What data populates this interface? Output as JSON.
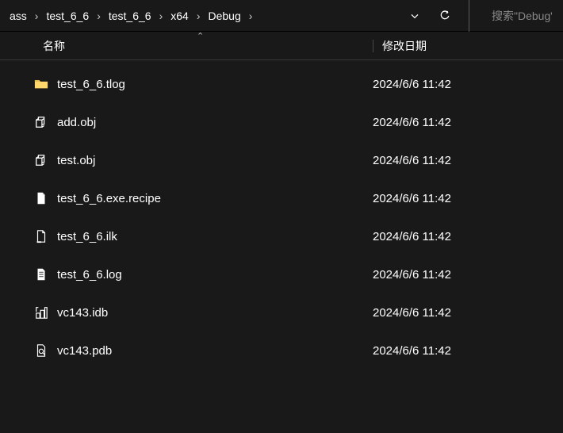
{
  "breadcrumb": {
    "items": [
      {
        "label": "ass"
      },
      {
        "label": "test_6_6"
      },
      {
        "label": "test_6_6"
      },
      {
        "label": "x64"
      },
      {
        "label": "Debug"
      }
    ]
  },
  "search": {
    "placeholder": "搜索\"Debug\""
  },
  "columns": {
    "name": "名称",
    "date": "修改日期"
  },
  "files": [
    {
      "icon": "folder",
      "name": "test_6_6.tlog",
      "date": "2024/6/6 11:42"
    },
    {
      "icon": "obj",
      "name": "add.obj",
      "date": "2024/6/6 11:42"
    },
    {
      "icon": "obj",
      "name": "test.obj",
      "date": "2024/6/6 11:42"
    },
    {
      "icon": "file",
      "name": "test_6_6.exe.recipe",
      "date": "2024/6/6 11:42"
    },
    {
      "icon": "ilk",
      "name": "test_6_6.ilk",
      "date": "2024/6/6 11:42"
    },
    {
      "icon": "log",
      "name": "test_6_6.log",
      "date": "2024/6/6 11:42"
    },
    {
      "icon": "idb",
      "name": "vc143.idb",
      "date": "2024/6/6 11:42"
    },
    {
      "icon": "pdb",
      "name": "vc143.pdb",
      "date": "2024/6/6 11:42"
    }
  ]
}
